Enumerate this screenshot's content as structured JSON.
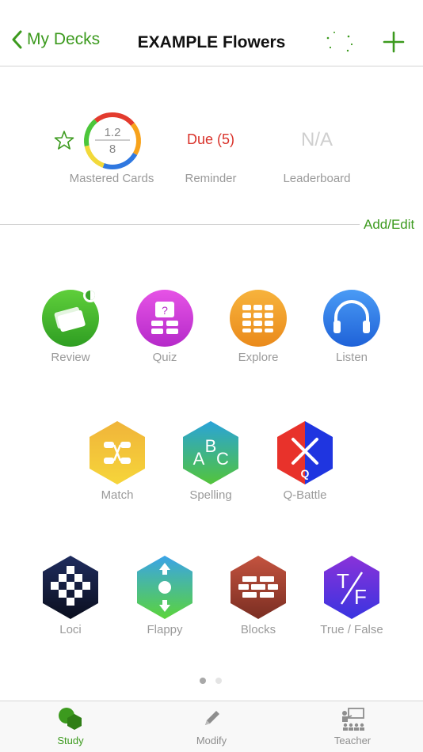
{
  "nav": {
    "back_label": "My Decks",
    "title": "EXAMPLE Flowers"
  },
  "stats": {
    "mastered_top": "1.2",
    "mastered_bottom": "8",
    "mastered_label": "Mastered Cards",
    "due_text": "Due (5)",
    "reminder_label": "Reminder",
    "leaderboard_value": "N/A",
    "leaderboard_label": "Leaderboard"
  },
  "add_edit_label": "Add/Edit",
  "apps": {
    "review": "Review",
    "quiz": "Quiz",
    "explore": "Explore",
    "listen": "Listen",
    "match": "Match",
    "spelling": "Spelling",
    "qbattle": "Q-Battle",
    "loci": "Loci",
    "flappy": "Flappy",
    "blocks": "Blocks",
    "truefalse": "True / False"
  },
  "tabs": {
    "study": "Study",
    "modify": "Modify",
    "teacher": "Teacher"
  },
  "colors": {
    "accent": "#3c9a1e",
    "due": "#d9322a"
  }
}
